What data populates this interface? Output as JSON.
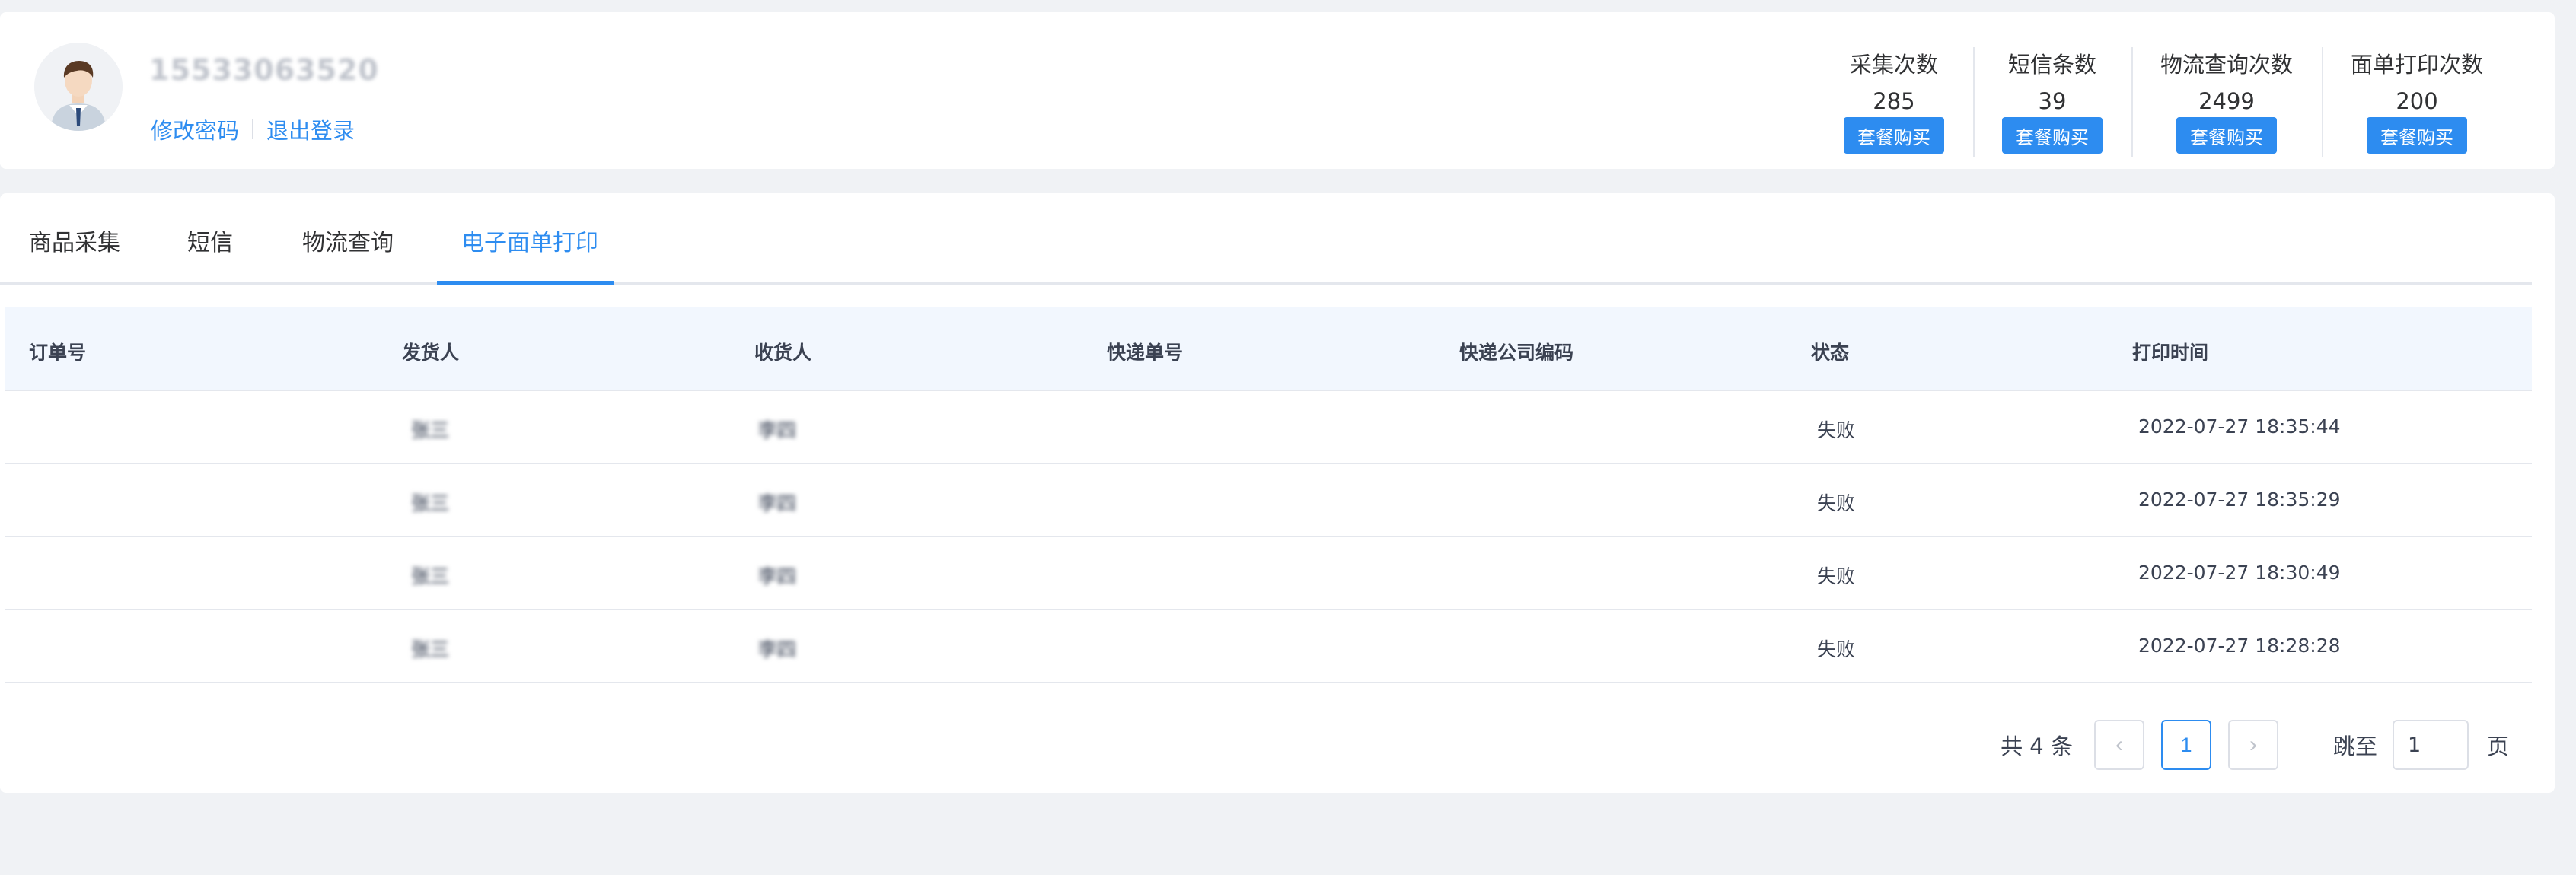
{
  "user": {
    "name": "15533063520",
    "change_password": "修改密码",
    "logout": "退出登录"
  },
  "stats": [
    {
      "label": "采集次数",
      "value": "285",
      "button": "套餐购买"
    },
    {
      "label": "短信条数",
      "value": "39",
      "button": "套餐购买"
    },
    {
      "label": "物流查询次数",
      "value": "2499",
      "button": "套餐购买"
    },
    {
      "label": "面单打印次数",
      "value": "200",
      "button": "套餐购买"
    }
  ],
  "tabs": [
    {
      "label": "商品采集"
    },
    {
      "label": "短信"
    },
    {
      "label": "物流查询"
    },
    {
      "label": "电子面单打印"
    }
  ],
  "active_tab": "电子面单打印",
  "table": {
    "headers": [
      "订单号",
      "发货人",
      "收货人",
      "快递单号",
      "快递公司编码",
      "状态",
      "打印时间"
    ],
    "rows": [
      {
        "order_no": "",
        "sender": "张三",
        "receiver": "李四",
        "tracking_no": "",
        "company_code": "",
        "status": "失败",
        "print_time": "2022-07-27 18:35:44"
      },
      {
        "order_no": "",
        "sender": "张三",
        "receiver": "李四",
        "tracking_no": "",
        "company_code": "",
        "status": "失败",
        "print_time": "2022-07-27 18:35:29"
      },
      {
        "order_no": "",
        "sender": "张三",
        "receiver": "李四",
        "tracking_no": "",
        "company_code": "",
        "status": "失败",
        "print_time": "2022-07-27 18:30:49"
      },
      {
        "order_no": "",
        "sender": "张三",
        "receiver": "李四",
        "tracking_no": "",
        "company_code": "",
        "status": "失败",
        "print_time": "2022-07-27 18:28:28"
      }
    ]
  },
  "pagination": {
    "total_text": "共 4 条",
    "prev_icon": "‹",
    "current_page": "1",
    "next_icon": "›",
    "jump_label": "跳至",
    "jump_value": "1",
    "page_unit": "页"
  },
  "colors": {
    "primary": "#2d8cf0",
    "background": "#f0f2f5",
    "table_header": "#f2f7fe"
  }
}
